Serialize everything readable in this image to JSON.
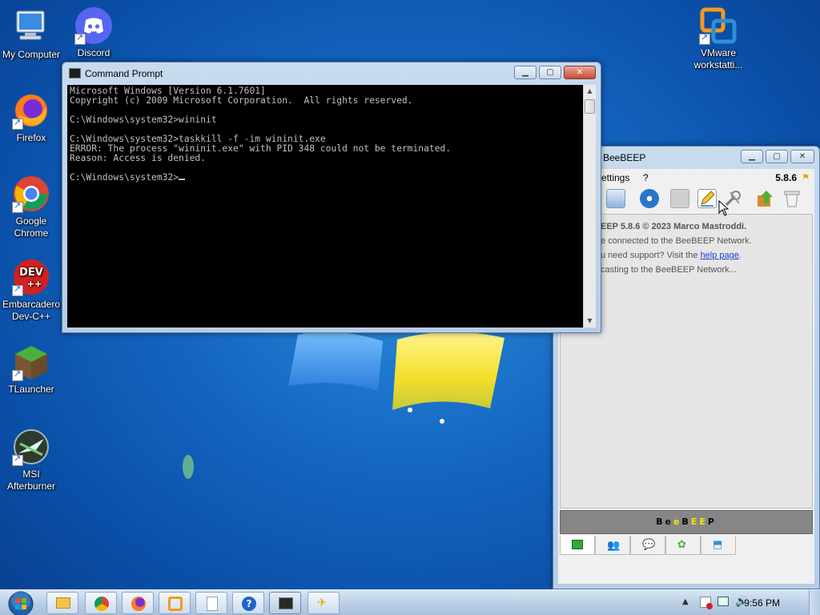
{
  "desktop": {
    "icons": [
      {
        "label": "My Computer"
      },
      {
        "label": "Discord"
      },
      {
        "label": "Firefox"
      },
      {
        "label": "Google Chrome"
      },
      {
        "label": "Embarcadero Dev-C++"
      },
      {
        "label": "TLauncher"
      },
      {
        "label": "MSI Afterburner"
      },
      {
        "label": "VMware workstatti..."
      }
    ]
  },
  "cmd": {
    "title": "Command Prompt",
    "lines": [
      "Microsoft Windows [Version 6.1.7601]",
      "Copyright (c) 2009 Microsoft Corporation.  All rights reserved.",
      "",
      "C:\\Windows\\system32>wininit",
      "",
      "C:\\Windows\\system32>taskkill -f -im wininit.exe",
      "ERROR: The process \"wininit.exe\" with PID 348 could not be terminated.",
      "Reason: Access is denied.",
      "",
      "C:\\Windows\\system32>"
    ]
  },
  "beebeep": {
    "title": "BeeBEEP",
    "menu_settings": "ettings",
    "menu_help": "?",
    "version": "5.8.6",
    "log": {
      "line1": "EEP 5.8.6 © 2023 Marco Mastroddi.",
      "line2": "e connected to the BeeBEEP Network.",
      "line3_pre": "u need support? Visit the ",
      "line3_link": "help page",
      "line3_post": ".",
      "line4": "casting to the BeeBEEP Network..."
    },
    "banner": [
      "B",
      "e",
      "e",
      "B",
      "E",
      "E",
      "P"
    ]
  },
  "taskbar": {
    "clock": "9:56 PM"
  },
  "colors": {
    "banner_letters": [
      "#000000",
      "#111111",
      "#f5e600",
      "#000000",
      "#f5e600",
      "#f5e600",
      "#000000"
    ]
  }
}
